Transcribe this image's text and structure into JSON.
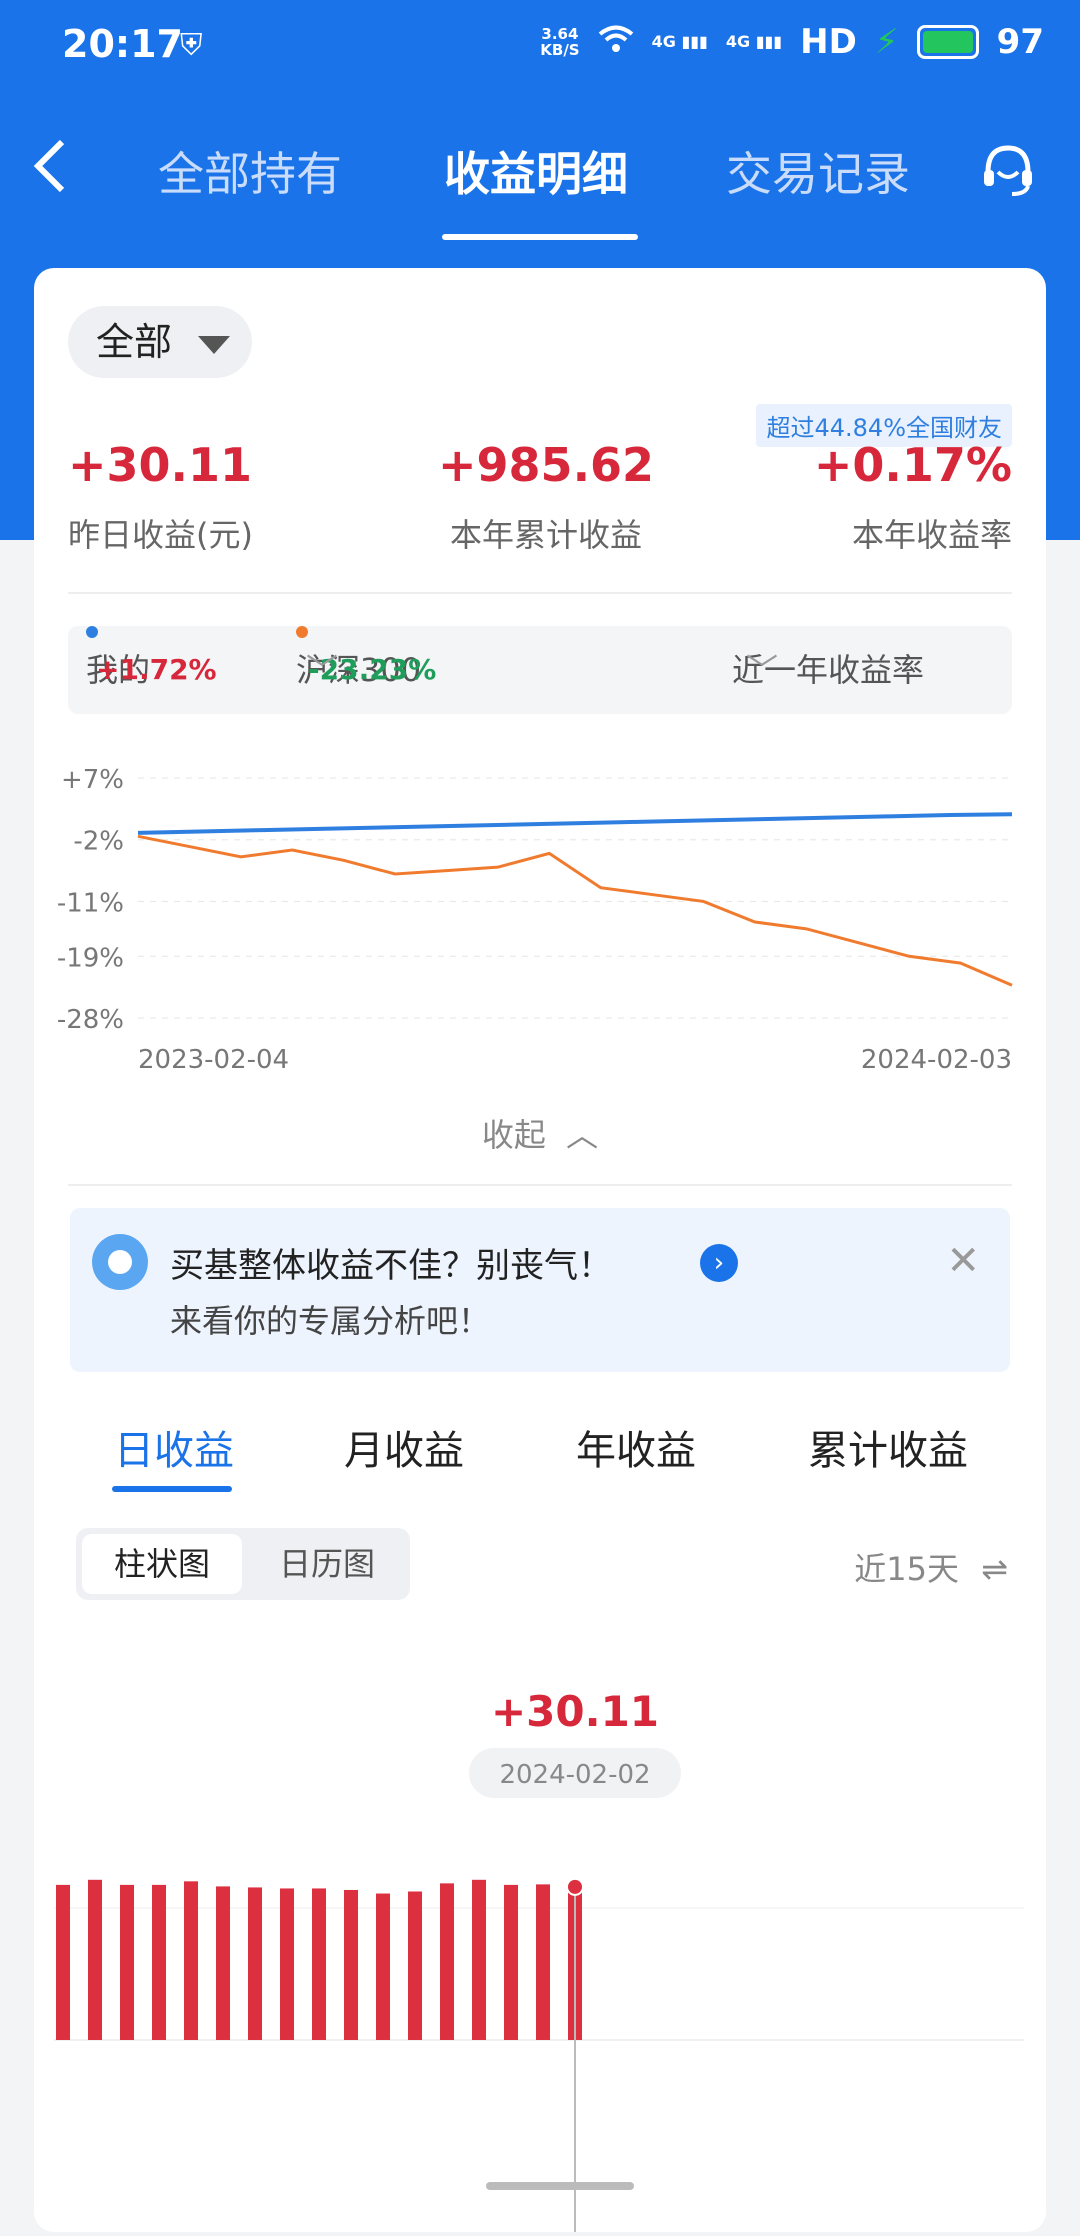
{
  "status_bar": {
    "time": "20:17",
    "net_speed_top": "3.64",
    "net_speed_unit": "KB/S",
    "signal_1": "4G",
    "signal_2": "4G",
    "hd": "HD",
    "battery": "97"
  },
  "nav": {
    "tabs": [
      "全部持有",
      "收益明细",
      "交易记录"
    ],
    "active_tab": "收益明细"
  },
  "filter": {
    "label": "全部"
  },
  "badge": "超过44.84%全国财友",
  "stats": [
    {
      "value": "+30.11",
      "label": "昨日收益(元)"
    },
    {
      "value": "+985.62",
      "label": "本年累计收益"
    },
    {
      "value": "+0.17%",
      "label": "本年收益率"
    }
  ],
  "compare": {
    "mine_label": "我的",
    "mine_value": "+1.72%",
    "index_label": "沪深300",
    "index_value": "-23.23%",
    "period_label": "近一年收益率"
  },
  "colors": {
    "accent": "#1a73e8",
    "gain": "#d6283a",
    "loss": "#1f9d5a",
    "mine_line": "#2f7fe0",
    "index_line": "#f07b2e"
  },
  "chart_data": {
    "type": "line",
    "y_ticks": [
      "+7%",
      "-2%",
      "-11%",
      "-19%",
      "-28%"
    ],
    "y_tick_values": [
      7,
      -2,
      -11,
      -19,
      -28
    ],
    "ylim": [
      -28,
      7
    ],
    "x_labels": [
      "2023-02-04",
      "2024-02-03"
    ],
    "series": [
      {
        "name": "我的",
        "values": [
          -1,
          -0.8,
          -0.6,
          -0.4,
          -0.2,
          0,
          0.2,
          0.4,
          0.6,
          0.8,
          1.0,
          1.2,
          1.4,
          1.6,
          1.72
        ]
      },
      {
        "name": "沪深300",
        "values": [
          -1.5,
          -3,
          -4.5,
          -3.5,
          -5,
          -7,
          -6.5,
          -6,
          -4,
          -9,
          -10,
          -11,
          -14,
          -15,
          -17,
          -19,
          -20,
          -23.23
        ]
      }
    ]
  },
  "collapse_label": "收起",
  "banner": {
    "title": "买基整体收益不佳？别丧气！",
    "subtitle": "来看你的专属分析吧！"
  },
  "period_tabs": [
    "日收益",
    "月收益",
    "年收益",
    "累计收益"
  ],
  "view_toggle": {
    "bar": "柱状图",
    "calendar": "日历图"
  },
  "range": "近15天",
  "bar_chart": {
    "selected_value": "+30.11",
    "selected_date": "2024-02-02",
    "values": [
      30.5,
      31.5,
      30.5,
      30.5,
      31.2,
      30.2,
      30,
      29.8,
      29.8,
      29.5,
      28.8,
      29.2,
      30.8,
      31.5,
      30.5,
      30.6,
      30.11
    ]
  }
}
